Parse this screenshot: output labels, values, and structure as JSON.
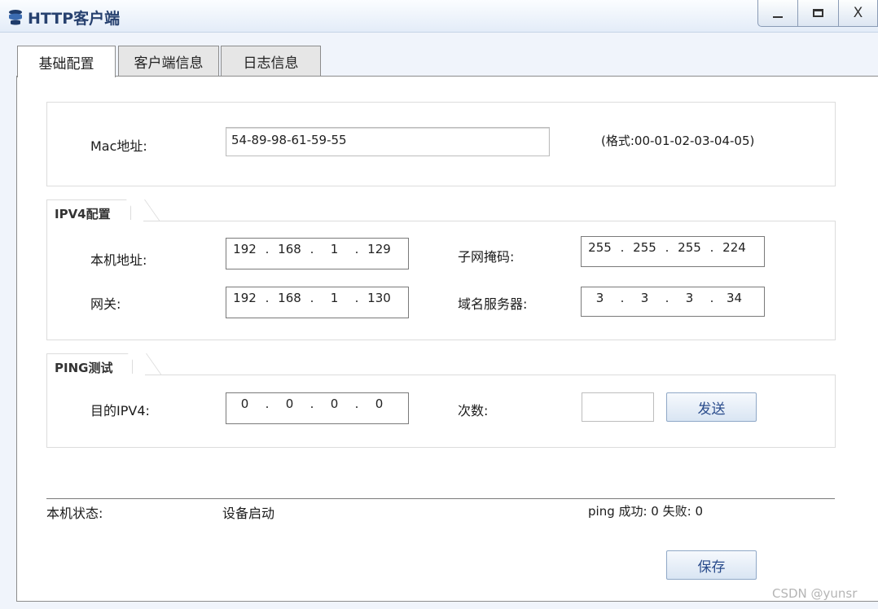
{
  "window": {
    "title": "HTTP客户端",
    "controls": {
      "minimize": "",
      "maximize": "",
      "close": "X"
    }
  },
  "tabs": [
    {
      "label": "基础配置",
      "active": true
    },
    {
      "label": "客户端信息",
      "active": false
    },
    {
      "label": "日志信息",
      "active": false
    }
  ],
  "mac": {
    "label": "Mac地址:",
    "value": "54-89-98-61-59-55",
    "format_hint": "(格式:00-01-02-03-04-05)"
  },
  "ipv4": {
    "group_title": "IPV4配置",
    "host_address": {
      "label": "本机地址:",
      "octets": [
        "192",
        "168",
        "1",
        "129"
      ]
    },
    "subnet_mask": {
      "label": "子网掩码:",
      "octets": [
        "255",
        "255",
        "255",
        "224"
      ]
    },
    "gateway": {
      "label": "网关:",
      "octets": [
        "192",
        "168",
        "1",
        "130"
      ]
    },
    "dns_server": {
      "label": "域名服务器:",
      "octets": [
        "3",
        "3",
        "3",
        "34"
      ]
    }
  },
  "ping": {
    "group_title": "PING测试",
    "target": {
      "label": "目的IPV4:",
      "octets": [
        "0",
        "0",
        "0",
        "0"
      ]
    },
    "count": {
      "label": "次数:",
      "value": ""
    },
    "send_button": "发送"
  },
  "status": {
    "label": "本机状态:",
    "value": "设备启动",
    "ping_result": "ping 成功: 0 失败: 0"
  },
  "save_button": "保存",
  "watermark": "CSDN @yunsr",
  "colors": {
    "title_text": "#27416f",
    "button_text": "#2a4c8c",
    "window_background": "#f0f4fb"
  }
}
